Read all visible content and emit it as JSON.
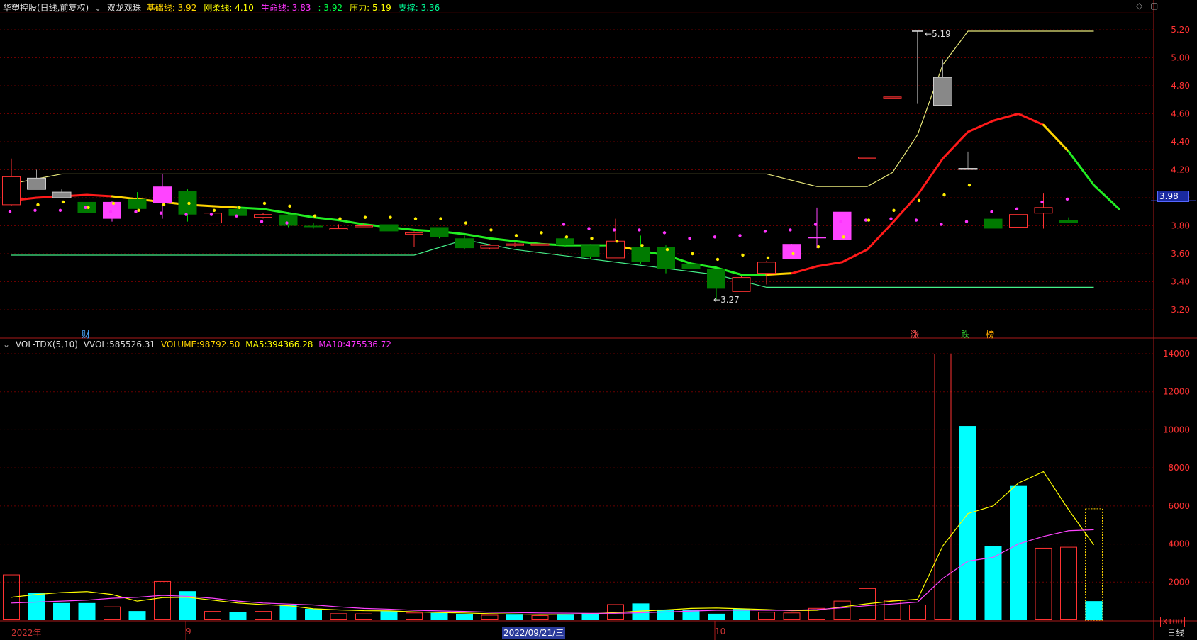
{
  "header": {
    "stock_title": "华塑控股(日线,前复权)",
    "indicator_name": "双龙戏珠",
    "items": [
      {
        "label": "基础线:",
        "value": "3.92",
        "color": "#ffd400"
      },
      {
        "label": "刚柔线:",
        "value": "4.10",
        "color": "#ffff00"
      },
      {
        "label": "生命线:",
        "value": "3.83",
        "color": "#ff33ff"
      },
      {
        "label": ":",
        "value": "3.92",
        "color": "#00ff44"
      },
      {
        "label": "压力:",
        "value": "5.19",
        "color": "#ffff00"
      },
      {
        "label": "支撑:",
        "value": "3.36",
        "color": "#00ff99"
      }
    ]
  },
  "vol_header": {
    "name": "VOL-TDX(5,10)",
    "vvol_label": "VVOL:",
    "vvol": "585526.31",
    "volume_label": "VOLUME:",
    "volume": "98792.50",
    "ma5_label": "MA5:",
    "ma5": "394366.28",
    "ma10_label": "MA10:",
    "ma10": "475536.72"
  },
  "markers": {
    "cai": "财",
    "zhang": "涨",
    "die": "跌",
    "bang": "榜"
  },
  "current_price_tag": "3.98",
  "high_label": "5.19",
  "low_label": "3.27",
  "x_labels": {
    "year": "2022年",
    "sep": "9",
    "date": "2022/09/21/三",
    "oct": "10"
  },
  "vol_unit": "X100",
  "period_button": "日线",
  "colors": {
    "up": "#ff3232",
    "down": "#00aa00",
    "grid": "#7a0000",
    "axis": "#cc2222",
    "price_text": "#ff3232",
    "vol": "#00ffff"
  },
  "chart_data": [
    {
      "type": "candlestick",
      "title": "华塑控股(日线,前复权)",
      "yticks": [
        3.2,
        3.4,
        3.6,
        3.8,
        4.0,
        4.2,
        4.4,
        4.6,
        4.8,
        5.0,
        5.2
      ],
      "ylim": [
        3.08,
        5.32
      ],
      "candles": [
        {
          "o": 3.95,
          "h": 4.28,
          "l": 3.94,
          "c": 4.15,
          "t": "red"
        },
        {
          "o": 4.14,
          "h": 4.2,
          "l": 4.06,
          "c": 4.06,
          "t": "gray"
        },
        {
          "o": 4.04,
          "h": 4.06,
          "l": 4.0,
          "c": 4.0,
          "t": "gray"
        },
        {
          "o": 3.97,
          "h": 3.98,
          "l": 3.89,
          "c": 3.89,
          "t": "green"
        },
        {
          "o": 3.97,
          "h": 3.98,
          "l": 3.83,
          "c": 3.85,
          "t": "magenta"
        },
        {
          "o": 3.92,
          "h": 4.04,
          "l": 3.92,
          "c": 3.99,
          "t": "green"
        },
        {
          "o": 4.08,
          "h": 4.17,
          "l": 3.85,
          "c": 3.96,
          "t": "magenta"
        },
        {
          "o": 4.05,
          "h": 4.06,
          "l": 3.83,
          "c": 3.88,
          "t": "green"
        },
        {
          "o": 3.89,
          "h": 3.89,
          "l": 3.82,
          "c": 3.82,
          "t": "red"
        },
        {
          "o": 3.92,
          "h": 3.93,
          "l": 3.86,
          "c": 3.87,
          "t": "green"
        },
        {
          "o": 3.88,
          "h": 3.89,
          "l": 3.85,
          "c": 3.86,
          "t": "red"
        },
        {
          "o": 3.88,
          "h": 3.88,
          "l": 3.79,
          "c": 3.8,
          "t": "green"
        },
        {
          "o": 3.8,
          "h": 3.82,
          "l": 3.78,
          "c": 3.79,
          "t": "green"
        },
        {
          "o": 3.78,
          "h": 3.81,
          "l": 3.77,
          "c": 3.77,
          "t": "red"
        },
        {
          "o": 3.8,
          "h": 3.82,
          "l": 3.79,
          "c": 3.8,
          "t": "red"
        },
        {
          "o": 3.81,
          "h": 3.82,
          "l": 3.75,
          "c": 3.76,
          "t": "green"
        },
        {
          "o": 3.75,
          "h": 3.76,
          "l": 3.65,
          "c": 3.74,
          "t": "red"
        },
        {
          "o": 3.79,
          "h": 3.79,
          "l": 3.71,
          "c": 3.72,
          "t": "green"
        },
        {
          "o": 3.71,
          "h": 3.73,
          "l": 3.63,
          "c": 3.64,
          "t": "green"
        },
        {
          "o": 3.66,
          "h": 3.67,
          "l": 3.63,
          "c": 3.64,
          "t": "red"
        },
        {
          "o": 3.67,
          "h": 3.68,
          "l": 3.65,
          "c": 3.66,
          "t": "red"
        },
        {
          "o": 3.67,
          "h": 3.69,
          "l": 3.64,
          "c": 3.66,
          "t": "red"
        },
        {
          "o": 3.71,
          "h": 3.72,
          "l": 3.65,
          "c": 3.66,
          "t": "green"
        },
        {
          "o": 3.66,
          "h": 3.66,
          "l": 3.56,
          "c": 3.58,
          "t": "green"
        },
        {
          "o": 3.57,
          "h": 3.85,
          "l": 3.57,
          "c": 3.69,
          "t": "red"
        },
        {
          "o": 3.65,
          "h": 3.73,
          "l": 3.53,
          "c": 3.54,
          "t": "green"
        },
        {
          "o": 3.65,
          "h": 3.66,
          "l": 3.46,
          "c": 3.49,
          "t": "green"
        },
        {
          "o": 3.53,
          "h": 3.54,
          "l": 3.48,
          "c": 3.49,
          "t": "green"
        },
        {
          "o": 3.49,
          "h": 3.49,
          "l": 3.27,
          "c": 3.35,
          "t": "green"
        },
        {
          "o": 3.33,
          "h": 3.44,
          "l": 3.33,
          "c": 3.43,
          "t": "red"
        },
        {
          "o": 3.46,
          "h": 3.55,
          "l": 3.38,
          "c": 3.54,
          "t": "red"
        },
        {
          "o": 3.56,
          "h": 3.67,
          "l": 3.56,
          "c": 3.67,
          "t": "magenta"
        },
        {
          "o": 3.71,
          "h": 3.93,
          "l": 3.64,
          "c": 3.72,
          "t": "magenta"
        },
        {
          "o": 3.7,
          "h": 3.95,
          "l": 3.7,
          "c": 3.9,
          "t": "magenta"
        },
        {
          "o": 4.29,
          "h": 4.29,
          "l": 4.29,
          "c": 4.29,
          "t": "red"
        },
        {
          "o": 4.72,
          "h": 4.72,
          "l": 4.72,
          "c": 4.72,
          "t": "red"
        },
        {
          "o": 4.67,
          "h": 5.19,
          "l": 4.67,
          "c": 5.19,
          "t": "white"
        },
        {
          "o": 4.66,
          "h": 4.99,
          "l": 4.66,
          "c": 4.86,
          "t": "gray"
        },
        {
          "o": 4.21,
          "h": 4.33,
          "l": 4.2,
          "c": 4.21,
          "t": "gray"
        },
        {
          "o": 3.85,
          "h": 3.95,
          "l": 3.78,
          "c": 3.78,
          "t": "green"
        },
        {
          "o": 3.79,
          "h": 3.88,
          "l": 3.79,
          "c": 3.88,
          "t": "red"
        },
        {
          "o": 3.89,
          "h": 4.03,
          "l": 3.78,
          "c": 3.93,
          "t": "red"
        },
        {
          "o": 3.84,
          "h": 3.86,
          "l": 3.82,
          "c": 3.82,
          "t": "green"
        }
      ],
      "base_line": [
        3.98,
        4.0,
        4.01,
        4.02,
        4.01,
        3.99,
        3.97,
        3.95,
        3.94,
        3.93,
        3.92,
        3.89,
        3.86,
        3.84,
        3.81,
        3.79,
        3.77,
        3.76,
        3.74,
        3.71,
        3.69,
        3.67,
        3.66,
        3.66,
        3.66,
        3.62,
        3.59,
        3.53,
        3.5,
        3.45,
        3.45,
        3.46,
        3.51,
        3.54,
        3.63,
        3.82,
        4.02,
        4.28,
        4.47,
        4.55,
        4.6,
        4.52,
        4.33,
        4.09,
        3.92
      ],
      "base_line_colors": [
        "red",
        "red",
        "red",
        "red",
        "yellow",
        "yellow",
        "yellow",
        "yellow",
        "yellow",
        "green",
        "green",
        "green",
        "green",
        "green",
        "green",
        "green",
        "green",
        "green",
        "green",
        "green",
        "green",
        "green",
        "green",
        "green",
        "yellow",
        "green",
        "green",
        "green",
        "green",
        "green",
        "yellow",
        "red",
        "red",
        "red",
        "red",
        "red",
        "red",
        "red",
        "red",
        "red",
        "red",
        "yellow",
        "green",
        "green",
        "green"
      ],
      "yellow_dots": [
        3.95,
        3.97,
        3.93,
        3.96,
        3.91,
        3.95,
        3.96,
        3.91,
        3.93,
        3.96,
        3.94,
        3.87,
        3.85,
        3.86,
        3.86,
        3.85,
        3.85,
        3.82,
        3.77,
        3.73,
        3.75,
        3.72,
        3.71,
        3.69,
        3.66,
        3.63,
        3.6,
        3.56,
        3.59,
        3.57,
        3.6,
        3.65,
        3.72,
        3.84,
        3.91,
        3.98,
        4.02,
        4.09
      ],
      "magenta_dots": [
        3.9,
        3.91,
        3.91,
        3.93,
        3.9,
        3.9,
        3.89,
        3.88,
        3.88,
        3.87,
        3.83,
        3.82,
        3.81,
        3.78,
        3.77,
        3.77,
        3.75,
        3.71,
        3.72,
        3.73,
        3.76,
        3.77,
        3.81,
        3.83,
        3.84,
        3.85,
        3.84,
        3.81,
        3.83,
        3.9,
        3.92,
        3.97,
        3.99
      ],
      "resistance": 5.19,
      "support": 3.36
    },
    {
      "type": "bar",
      "title": "VOL-TDX(5,10)",
      "yticks": [
        2000,
        4000,
        6000,
        8000,
        10000,
        12000,
        14000
      ],
      "ylim": [
        0,
        14700
      ],
      "volumes": [
        2400,
        1450,
        900,
        900,
        720,
        480,
        2050,
        1520,
        480,
        420,
        480,
        820,
        600,
        360,
        350,
        480,
        400,
        380,
        330,
        280,
        290,
        260,
        290,
        360,
        840,
        880,
        560,
        560,
        340,
        600,
        440,
        400,
        640,
        1020,
        1680,
        1060,
        820,
        14000,
        10200,
        3900,
        7050,
        3800,
        3850,
        5850
      ],
      "colors": [
        "red",
        "cyan",
        "cyan",
        "cyan",
        "red",
        "cyan",
        "red",
        "cyan",
        "red",
        "cyan",
        "red",
        "cyan",
        "cyan",
        "red",
        "red",
        "cyan",
        "red",
        "cyan",
        "cyan",
        "red",
        "cyan",
        "red",
        "cyan",
        "cyan",
        "red",
        "cyan",
        "cyan",
        "cyan",
        "cyan",
        "cyan",
        "red",
        "red",
        "red",
        "red",
        "red",
        "red",
        "red",
        "red",
        "cyan",
        "cyan",
        "cyan",
        "red",
        "red",
        "cyan"
      ],
      "ma5": [
        1200,
        1350,
        1450,
        1500,
        1350,
        1000,
        1180,
        1200,
        1050,
        900,
        820,
        760,
        600,
        540,
        500,
        490,
        440,
        400,
        380,
        340,
        320,
        300,
        310,
        330,
        400,
        480,
        540,
        620,
        640,
        600,
        560,
        500,
        520,
        700,
        860,
        1000,
        1100,
        3900,
        5600,
        6000,
        7200,
        7800,
        5800,
        3950
      ],
      "ma10": [
        900,
        950,
        1000,
        1050,
        1150,
        1200,
        1300,
        1250,
        1150,
        1000,
        900,
        850,
        800,
        700,
        620,
        580,
        520,
        490,
        460,
        420,
        400,
        380,
        370,
        360,
        360,
        390,
        430,
        480,
        520,
        530,
        520,
        520,
        560,
        650,
        760,
        850,
        950,
        2200,
        3100,
        3300,
        4000,
        4400,
        4700,
        4750
      ]
    }
  ]
}
